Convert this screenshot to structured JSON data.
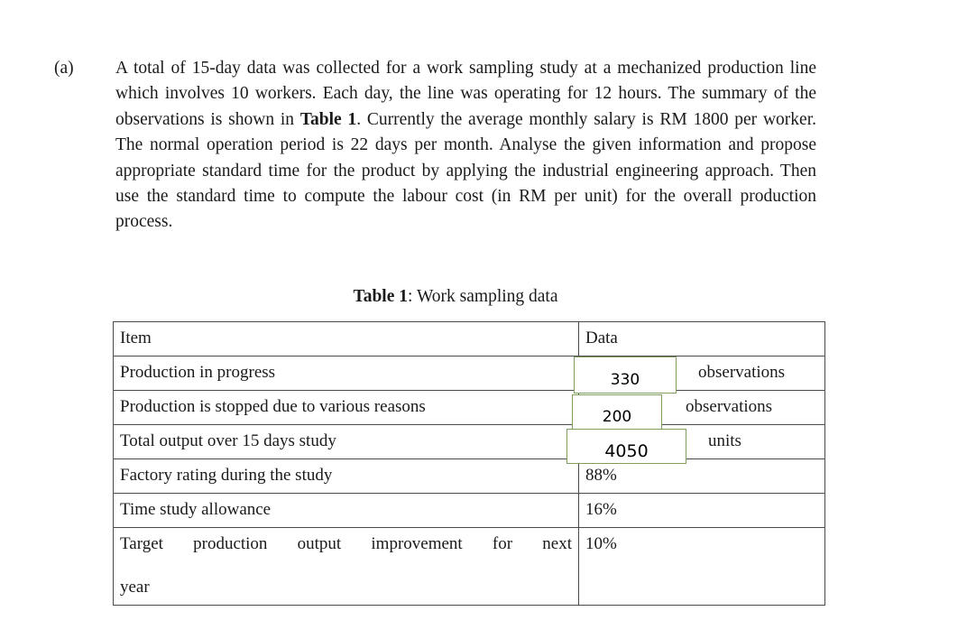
{
  "document": {
    "question": {
      "label": "(a)",
      "text": "A total of 15-day data was collected for a work sampling study at a mechanized production line which involves 10 workers. Each day, the line was operating for 12 hours. The summary of the observations is shown in ",
      "text_bold_ref": "Table 1",
      "text_after_ref": ". Currently the average monthly salary is RM 1800 per worker. The normal operation period is 22 days per month. Analyse the given information and propose appropriate standard time for the product by applying the industrial engineering approach. Then use the standard time to compute the labour cost (in RM per unit) for the overall production process."
    },
    "table": {
      "caption_strong": "Table 1",
      "caption_rest": ": Work sampling data",
      "headers": {
        "item": "Item",
        "data": "Data"
      },
      "rows": [
        {
          "item": "Production in progress",
          "data_value": "330",
          "data_unit": "observations"
        },
        {
          "item": "Production is stopped due to various reasons",
          "data_value": "200",
          "data_unit": "observations"
        },
        {
          "item": "Total output over 15 days study",
          "data_value": "4050",
          "data_unit": "units"
        },
        {
          "item": "Factory rating during the study",
          "data_value": "88%",
          "data_unit": ""
        },
        {
          "item": "Time study allowance",
          "data_value": "16%",
          "data_unit": ""
        },
        {
          "item_line1": "Target production output improvement for next",
          "item_line2": "year",
          "data_value": "10%",
          "data_unit": ""
        }
      ]
    },
    "annotations": {
      "accent_color": "#7f9d5c",
      "boxes": [
        {
          "value": "330"
        },
        {
          "value": "200"
        },
        {
          "value": "4050"
        }
      ]
    }
  }
}
